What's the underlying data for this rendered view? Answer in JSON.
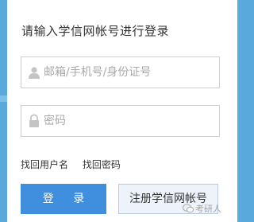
{
  "login": {
    "title": "请输入学信网帐号进行登录",
    "username": {
      "placeholder": "邮箱/手机号/身份证号",
      "value": "",
      "icon": "user-icon"
    },
    "password": {
      "placeholder": "密码",
      "value": "",
      "icon": "lock-icon"
    },
    "links": {
      "find_username": "找回用户名",
      "find_password": "找回密码"
    },
    "buttons": {
      "login": "登 录",
      "register": "注册学信网帐号"
    }
  },
  "watermark": {
    "text": "考研人",
    "icon": "wechat-icon"
  },
  "colors": {
    "background": "#5aa9dd",
    "login_button": "#3f8fde",
    "register_button_bg": "#eef3fb",
    "border": "#cfcfcf"
  }
}
